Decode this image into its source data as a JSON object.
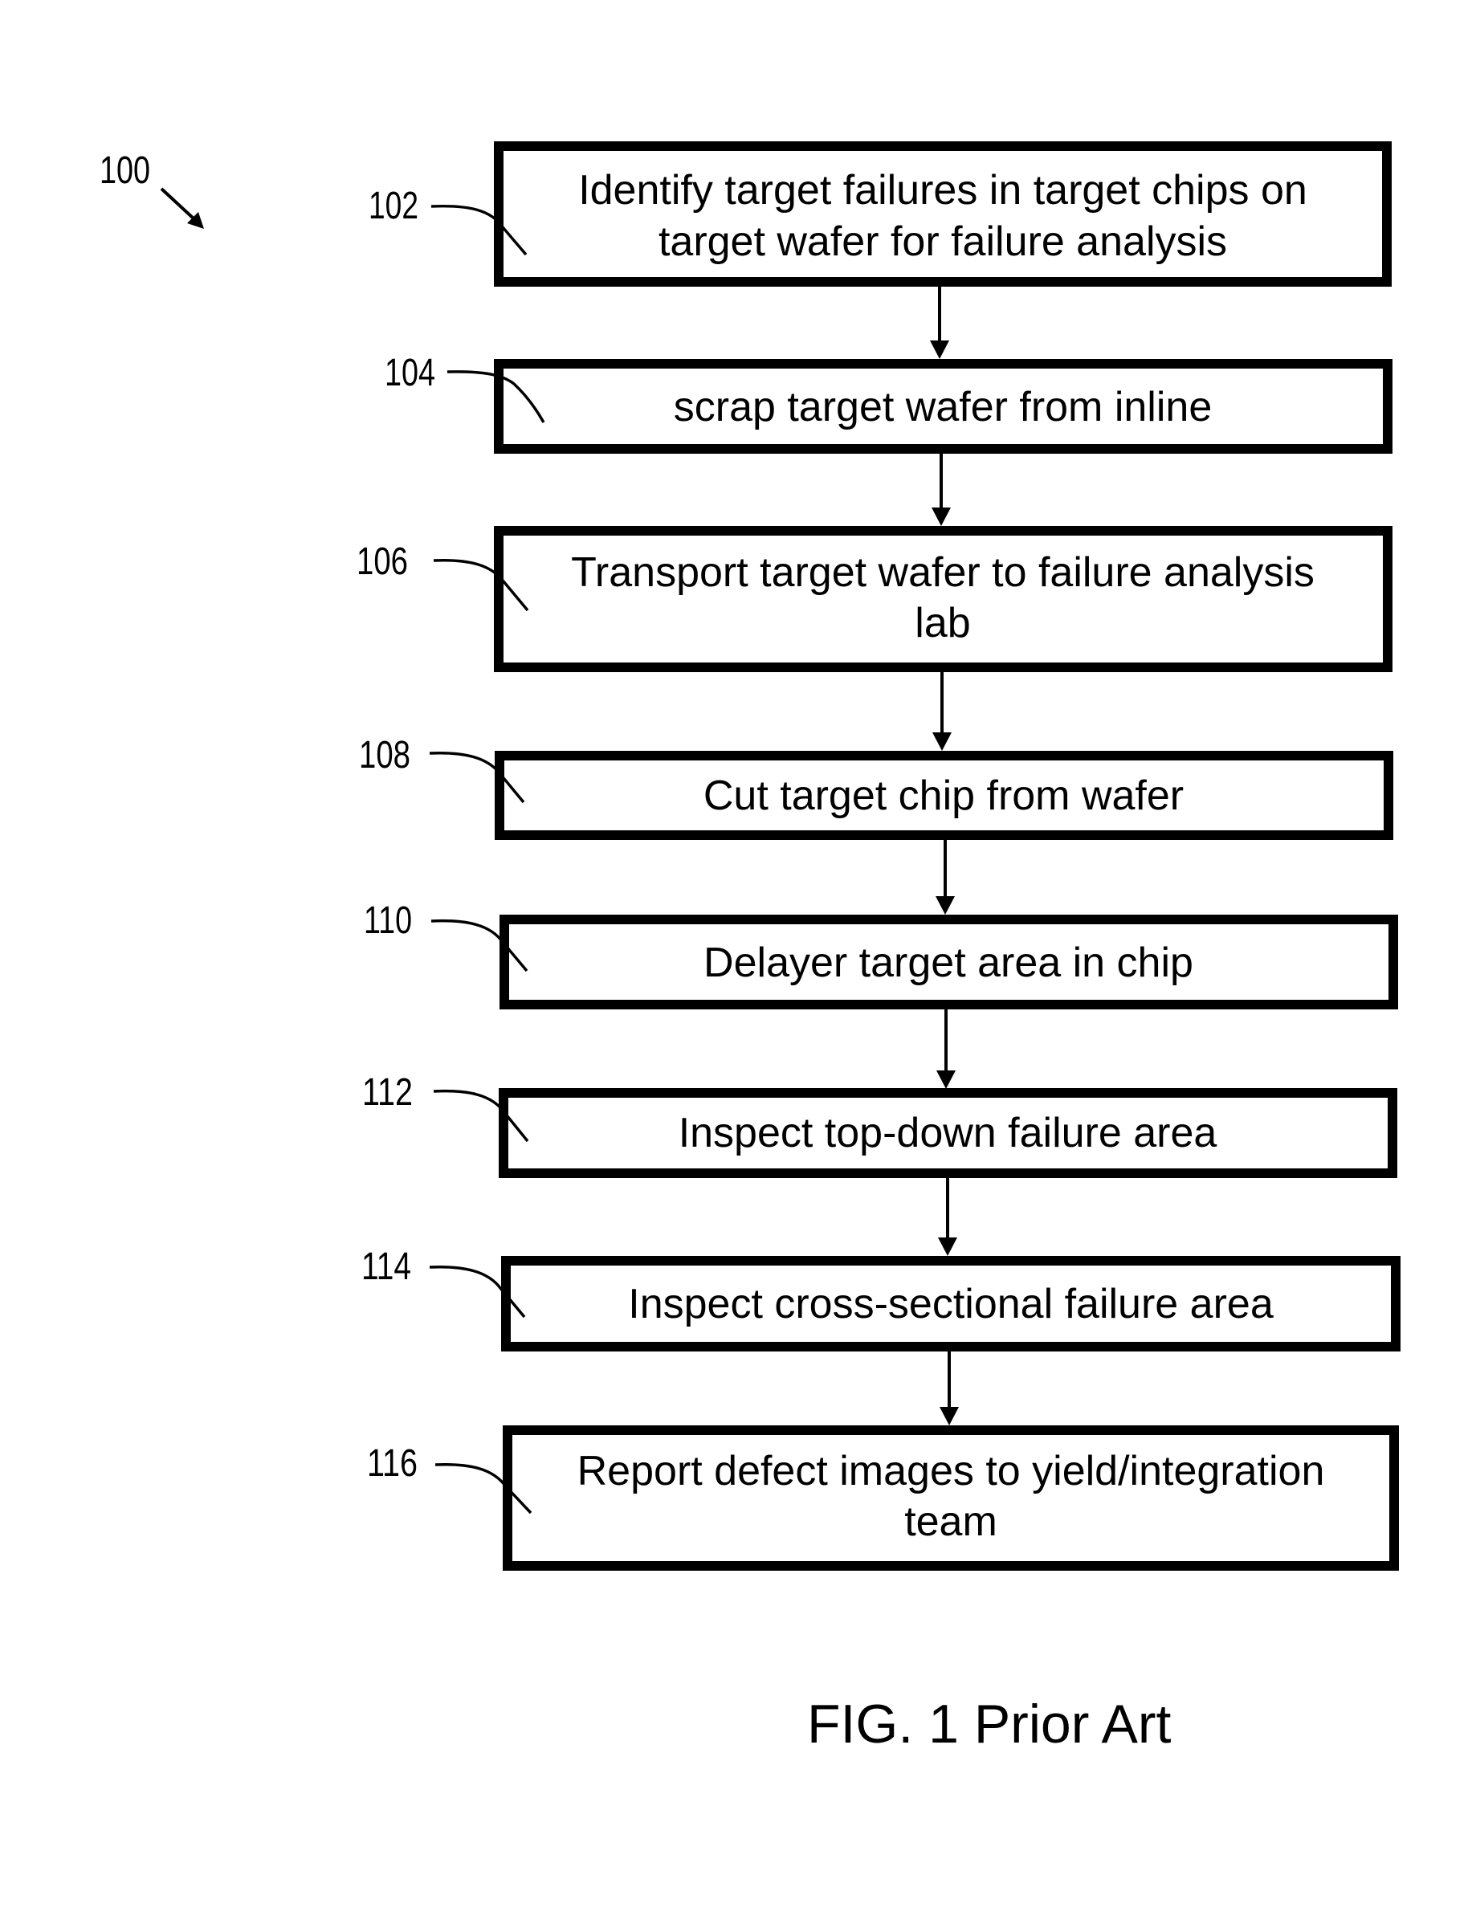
{
  "figure": {
    "reference": "100",
    "caption": "FIG. 1 Prior Art",
    "steps": [
      {
        "ref": "102",
        "lines": [
          "Identify target failures in target chips on",
          "target wafer for failure analysis"
        ]
      },
      {
        "ref": "104",
        "lines": [
          "scrap target wafer from inline"
        ]
      },
      {
        "ref": "106",
        "lines": [
          "Transport target wafer to failure analysis",
          "lab"
        ]
      },
      {
        "ref": "108",
        "lines": [
          "Cut target chip from wafer"
        ]
      },
      {
        "ref": "110",
        "lines": [
          "Delayer target area in chip"
        ]
      },
      {
        "ref": "112",
        "lines": [
          "Inspect top-down failure area"
        ]
      },
      {
        "ref": "114",
        "lines": [
          "Inspect cross-sectional failure area"
        ]
      },
      {
        "ref": "116",
        "lines": [
          "Report defect images to yield/integration",
          "team"
        ]
      }
    ],
    "connections": [
      {
        "from": "102",
        "to": "104"
      },
      {
        "from": "104",
        "to": "106"
      },
      {
        "from": "106",
        "to": "108"
      },
      {
        "from": "108",
        "to": "110"
      },
      {
        "from": "110",
        "to": "112"
      },
      {
        "from": "112",
        "to": "114"
      },
      {
        "from": "114",
        "to": "116"
      }
    ]
  }
}
